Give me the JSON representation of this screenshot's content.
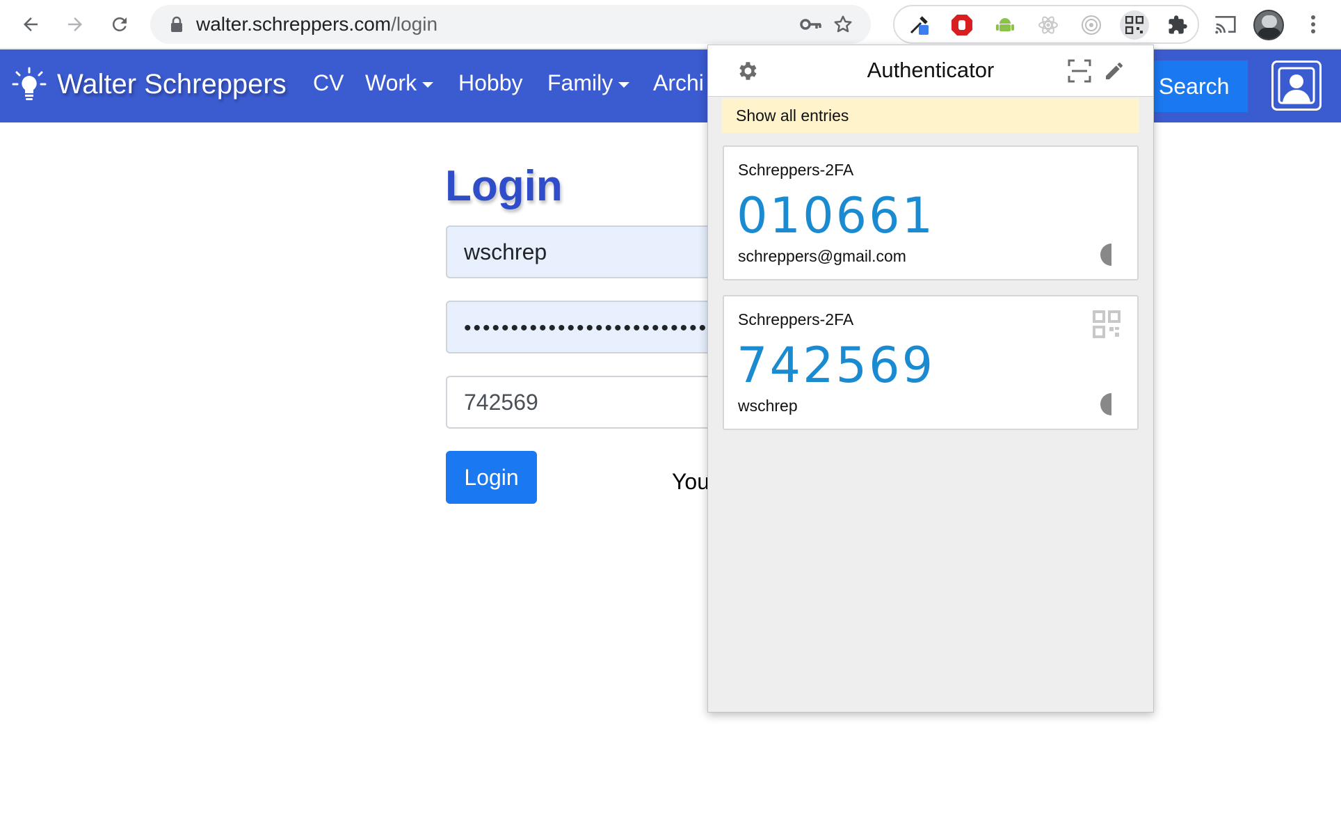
{
  "browser": {
    "url_host": "walter.schreppers.com",
    "url_path": "/login"
  },
  "navbar": {
    "brand": "Walter Schreppers",
    "links": [
      "CV",
      "Work",
      "Hobby",
      "Family",
      "Archi"
    ],
    "search_label": "Search"
  },
  "login": {
    "title": "Login",
    "username_value": "wschrep",
    "password_value": "••••••••••••••••••••••••••••",
    "otp_value": "742569",
    "button_label": "Login",
    "side_text": "You"
  },
  "authenticator": {
    "title": "Authenticator",
    "notice": "Show all entries",
    "entries": [
      {
        "issuer": "Schreppers-2FA",
        "code": "010661",
        "account": "schreppers@gmail.com"
      },
      {
        "issuer": "Schreppers-2FA",
        "code": "742569",
        "account": "wschrep"
      }
    ]
  },
  "colors": {
    "navbar": "#3b5bd0",
    "primary_button": "#1a78f0",
    "otp_code": "#1a8bd0",
    "notice_bg": "#fff3cc"
  },
  "icons": [
    "back-arrow-icon",
    "forward-arrow-icon",
    "reload-icon",
    "lock-icon",
    "key-icon",
    "star-icon",
    "eyedropper-icon",
    "stop-hand-icon",
    "android-icon",
    "atom-icon",
    "target-icon",
    "qr-code-icon",
    "puzzle-icon",
    "cast-icon",
    "more-vert-icon",
    "lightbulb-icon",
    "user-icon",
    "gear-icon",
    "scan-icon",
    "pencil-icon",
    "timer-icon"
  ]
}
